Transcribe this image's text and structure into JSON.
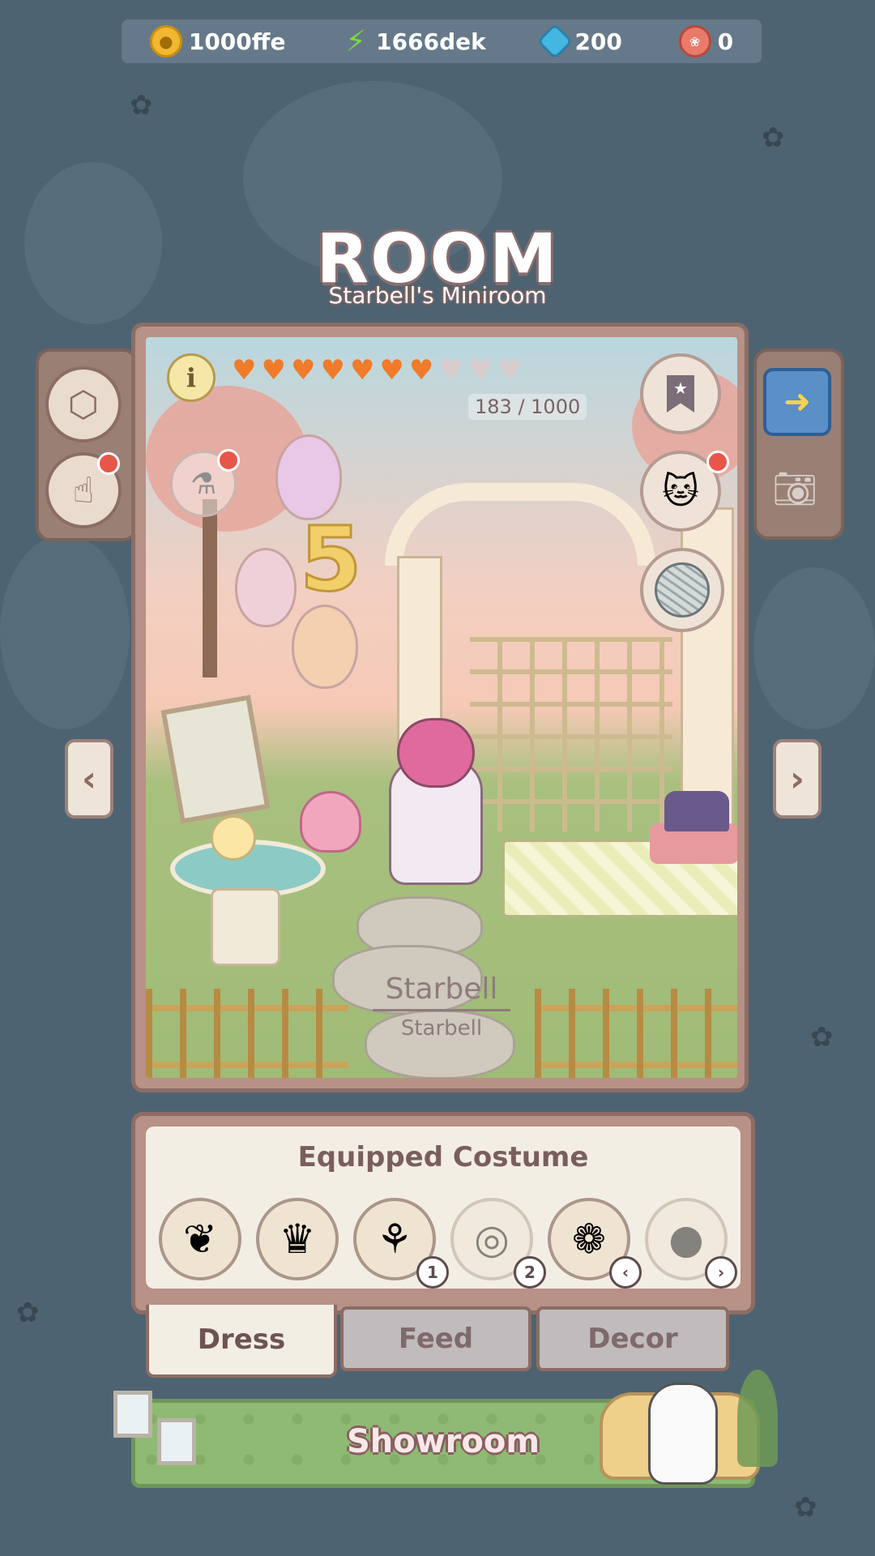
{
  "currencies": [
    {
      "name": "coins",
      "icon": "coin-icon",
      "value": "1000ffe"
    },
    {
      "name": "energy",
      "icon": "lightning-icon",
      "value": "1666dek"
    },
    {
      "name": "gems",
      "icon": "gem-icon",
      "value": "200"
    },
    {
      "name": "paws",
      "icon": "paw-icon",
      "value": "0"
    }
  ],
  "header": {
    "title": "ROOM",
    "subtitle": "Starbell's Miniroom"
  },
  "room": {
    "affection_hearts_filled": 7,
    "affection_hearts_total": 10,
    "affection_progress": "183 / 1000",
    "cat_name": "Starbell",
    "cat_name_sub": "Starbell"
  },
  "costume_panel": {
    "title": "Equipped Costume",
    "slots": [
      {
        "icon": "flower-vine-icon",
        "badge": ""
      },
      {
        "icon": "flower-crown-icon",
        "badge": ""
      },
      {
        "icon": "bouquet-icon",
        "badge": "1"
      },
      {
        "icon": "glasses-icon",
        "badge": "2"
      },
      {
        "icon": "tulip-hamster-icon",
        "badge": ""
      },
      {
        "icon": "cat-silhouette-icon",
        "badge": ""
      }
    ]
  },
  "tabs": [
    {
      "label": "Dress",
      "active": true
    },
    {
      "label": "Feed",
      "active": false
    },
    {
      "label": "Decor",
      "active": false
    }
  ],
  "showroom": {
    "label": "Showroom"
  },
  "colors": {
    "background": "#4e6371",
    "frame": "#8b6d65",
    "heart": "#f07b2a",
    "showroom": "#8fba73"
  }
}
